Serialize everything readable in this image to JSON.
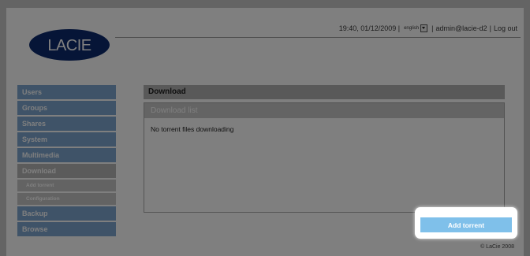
{
  "brand": {
    "logo_text": "LACIE",
    "logo_color": "#0d2a6e"
  },
  "userbar": {
    "datetime": "19:40, 01/12/2009 |",
    "language": "english",
    "separator": "|",
    "user": "admin@lacie-d2",
    "divider": "|",
    "logout_label": "Log out"
  },
  "sidebar": {
    "items": [
      {
        "label": "Users"
      },
      {
        "label": "Groups"
      },
      {
        "label": "Shares"
      },
      {
        "label": "System"
      },
      {
        "label": "Multimedia"
      },
      {
        "label": "Download",
        "active": true
      },
      {
        "label": "Backup"
      },
      {
        "label": "Browse"
      }
    ],
    "subitems": [
      {
        "label": "Add torrent"
      },
      {
        "label": "Configuration"
      }
    ]
  },
  "main": {
    "title": "Download",
    "list_header": "Download list",
    "empty_message": "No torrent files downloading"
  },
  "actions": {
    "add_torrent_label": "Add torrent"
  },
  "footer": {
    "copyright": "© LaCie 2008"
  },
  "colors": {
    "nav_blue": "#7fa6d1",
    "nav_active": "#b7b7b7",
    "button_blue": "#7fc0ea"
  }
}
